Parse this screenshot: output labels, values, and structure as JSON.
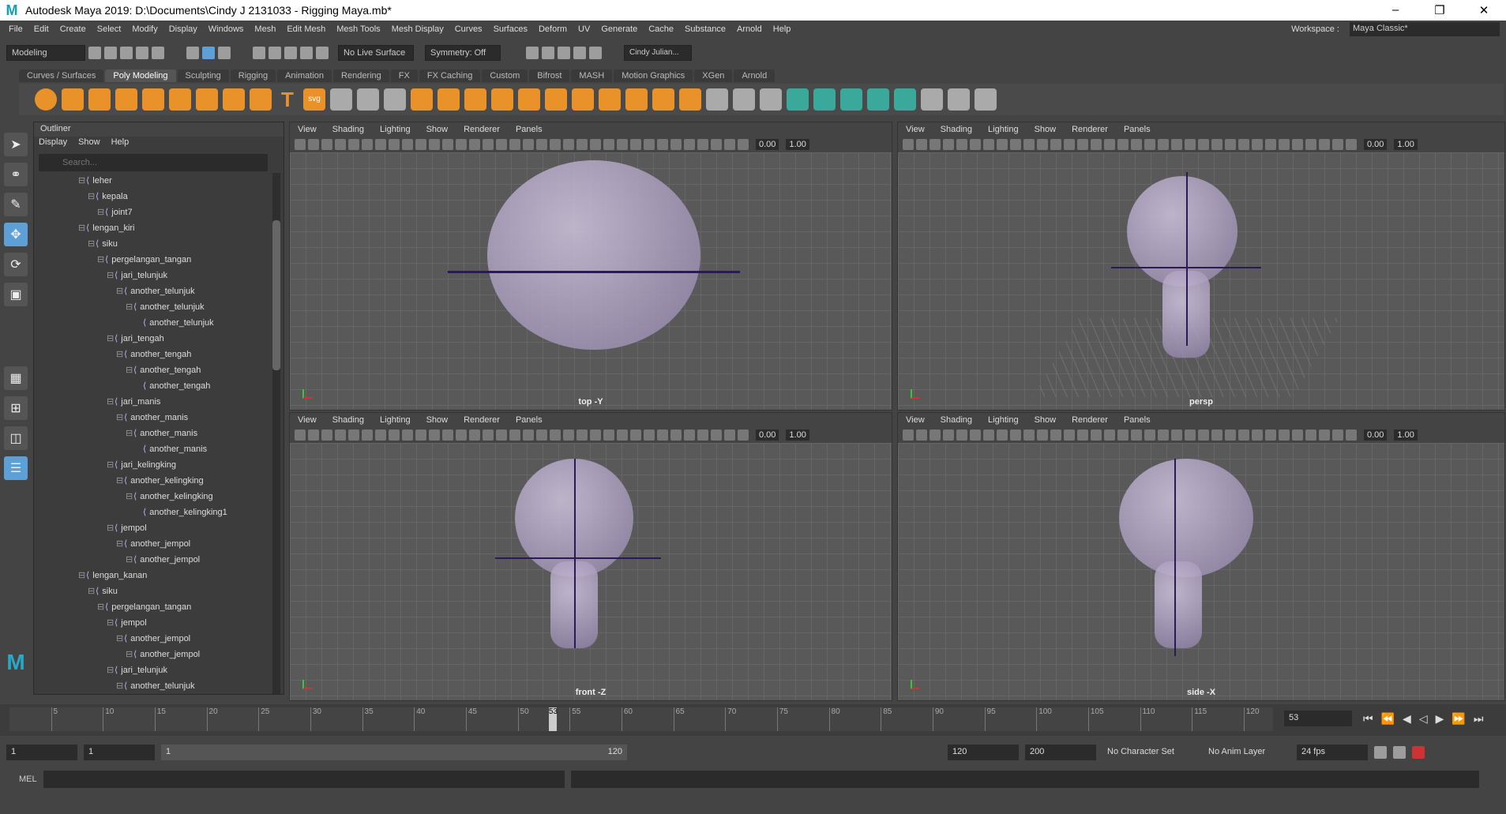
{
  "window": {
    "title": "Autodesk Maya 2019: D:\\Documents\\Cindy J 2131033 - Rigging Maya.mb*",
    "logo": "M"
  },
  "menu": [
    "File",
    "Edit",
    "Create",
    "Select",
    "Modify",
    "Display",
    "Windows",
    "Mesh",
    "Edit Mesh",
    "Mesh Tools",
    "Mesh Display",
    "Curves",
    "Surfaces",
    "Deform",
    "UV",
    "Generate",
    "Cache",
    "Substance",
    "Arnold",
    "Help"
  ],
  "workspace": {
    "label": "Workspace :",
    "value": "Maya Classic*"
  },
  "status": {
    "mode": "Modeling",
    "live_surface": "No Live Surface",
    "symmetry": "Symmetry: Off",
    "user": "Cindy Julian..."
  },
  "shelf_tabs": [
    "Curves / Surfaces",
    "Poly Modeling",
    "Sculpting",
    "Rigging",
    "Animation",
    "Rendering",
    "FX",
    "FX Caching",
    "Custom",
    "Bifrost",
    "MASH",
    "Motion Graphics",
    "XGen",
    "Arnold"
  ],
  "shelf_active": "Poly Modeling",
  "shelf_text_icons": {
    "text": "T",
    "svg": "svg"
  },
  "outliner": {
    "title": "Outliner",
    "menu": [
      "Display",
      "Show",
      "Help"
    ],
    "search_placeholder": "Search...",
    "items": [
      {
        "label": "leher",
        "depth": 0
      },
      {
        "label": "kepala",
        "depth": 1
      },
      {
        "label": "joint7",
        "depth": 2
      },
      {
        "label": "lengan_kiri",
        "depth": 0
      },
      {
        "label": "siku",
        "depth": 1
      },
      {
        "label": "pergelangan_tangan",
        "depth": 2
      },
      {
        "label": "jari_telunjuk",
        "depth": 3
      },
      {
        "label": "another_telunjuk",
        "depth": 4
      },
      {
        "label": "another_telunjuk",
        "depth": 5
      },
      {
        "label": "another_telunjuk",
        "depth": 6
      },
      {
        "label": "jari_tengah",
        "depth": 3
      },
      {
        "label": "another_tengah",
        "depth": 4
      },
      {
        "label": "another_tengah",
        "depth": 5
      },
      {
        "label": "another_tengah",
        "depth": 6
      },
      {
        "label": "jari_manis",
        "depth": 3
      },
      {
        "label": "another_manis",
        "depth": 4
      },
      {
        "label": "another_manis",
        "depth": 5
      },
      {
        "label": "another_manis",
        "depth": 6
      },
      {
        "label": "jari_kelingking",
        "depth": 3
      },
      {
        "label": "another_kelingking",
        "depth": 4
      },
      {
        "label": "another_kelingking",
        "depth": 5
      },
      {
        "label": "another_kelingking1",
        "depth": 6
      },
      {
        "label": "jempol",
        "depth": 3
      },
      {
        "label": "another_jempol",
        "depth": 4
      },
      {
        "label": "another_jempol",
        "depth": 5
      },
      {
        "label": "lengan_kanan",
        "depth": 0
      },
      {
        "label": "siku",
        "depth": 1
      },
      {
        "label": "pergelangan_tangan",
        "depth": 2
      },
      {
        "label": "jempol",
        "depth": 3
      },
      {
        "label": "another_jempol",
        "depth": 4
      },
      {
        "label": "another_jempol",
        "depth": 5
      },
      {
        "label": "jari_telunjuk",
        "depth": 3
      },
      {
        "label": "another_telunjuk",
        "depth": 4
      }
    ]
  },
  "viewport_menu": [
    "View",
    "Shading",
    "Lighting",
    "Show",
    "Renderer",
    "Panels"
  ],
  "viewport_values": {
    "a": "0.00",
    "b": "1.00"
  },
  "viewports": [
    {
      "name": "top -Y"
    },
    {
      "name": "persp"
    },
    {
      "name": "front -Z"
    },
    {
      "name": "side -X"
    }
  ],
  "timeline": {
    "ticks": [
      5,
      10,
      15,
      20,
      25,
      30,
      35,
      40,
      45,
      50,
      55,
      60,
      65,
      70,
      75,
      80,
      85,
      90,
      95,
      100,
      105,
      110,
      115,
      120
    ],
    "current": "53",
    "current_field": "53"
  },
  "range": {
    "start": "1",
    "start2": "1",
    "slider_start": "1",
    "slider_end": "120",
    "end": "120",
    "end2": "200",
    "character_set": "No Character Set",
    "anim_layer": "No Anim Layer",
    "fps": "24 fps"
  },
  "command": {
    "label": "MEL"
  },
  "colors": {
    "accent": "#5da0d8",
    "shelf_orange": "#e9922a",
    "shelf_teal": "#3aa89a"
  }
}
